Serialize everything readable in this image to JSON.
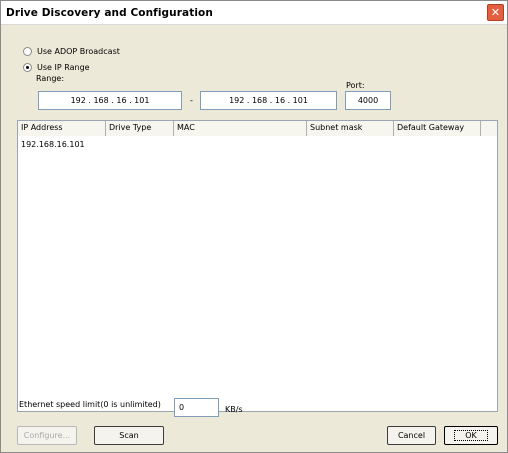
{
  "window": {
    "title": "Drive Discovery and Configuration",
    "close_glyph": "✕"
  },
  "discovery": {
    "option_adop": "Use ADOP Broadcast",
    "option_ip": "Use IP Range",
    "selected": "Use IP Range",
    "range_label": "Range:",
    "range_start": "192 . 168 . 16 . 101",
    "dash": "-",
    "range_end": "192 . 168 . 16 . 101",
    "port_label": "Port:",
    "port_value": "4000"
  },
  "list": {
    "columns": [
      "IP Address",
      "Drive Type",
      "MAC",
      "Subnet mask",
      "Default Gateway"
    ],
    "rows": [
      {
        "ip": "192.168.16.101",
        "drive_type": "",
        "mac": "",
        "subnet": "",
        "gateway": ""
      }
    ]
  },
  "speed": {
    "label": "Ethernet speed limit(0 is unlimited)",
    "value": "0",
    "unit": "KB/s"
  },
  "buttons": {
    "configure": "Configure...",
    "scan": "Scan",
    "cancel": "Cancel",
    "ok": "OK"
  }
}
